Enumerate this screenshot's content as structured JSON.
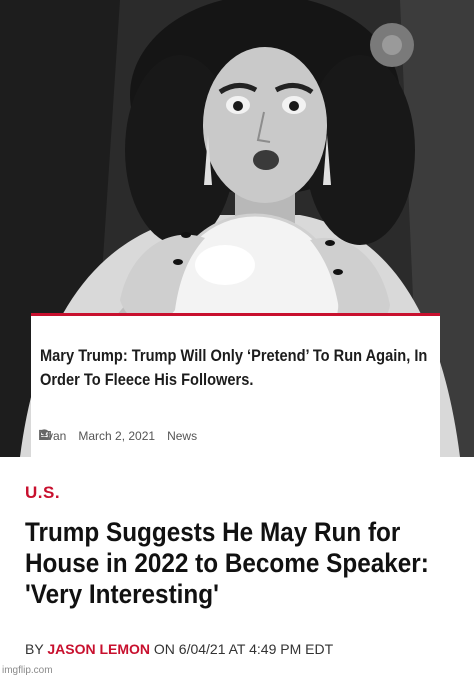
{
  "card": {
    "title": "Mary Trump: Trump Will Only ‘Pretend’ To Run Again, In Order To Fleece His Followers.",
    "author": "Evan",
    "date": "March 2, 2021",
    "category": "News",
    "accent_color": "#c8102e"
  },
  "article": {
    "section": "U.S.",
    "headline": "Trump Suggests He May Run for House in 2022 to Become Speaker: 'Very Interesting'",
    "byline_prefix": "BY",
    "author": "JASON LEMON",
    "byline_suffix": "ON 6/04/21 AT 4:49 PM EDT"
  },
  "watermark": "imgflip.com",
  "icons": [
    "user-icon",
    "clock-icon",
    "folder-icon"
  ]
}
